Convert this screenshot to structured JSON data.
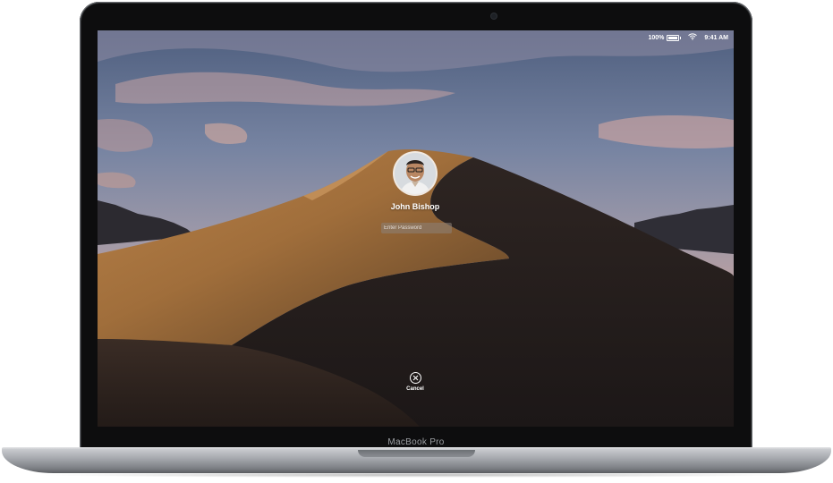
{
  "device": {
    "model_label": "MacBook Pro"
  },
  "status_bar": {
    "battery_percent": "100%",
    "time": "9:41 AM",
    "icons": [
      "battery-icon",
      "wifi-icon"
    ]
  },
  "login": {
    "user_name": "John Bishop",
    "password_placeholder": "Enter Password",
    "password_value": "",
    "cancel_label": "Cancel"
  },
  "colors": {
    "bezel": "#0d0d0e",
    "aluminum": "#a9acb1",
    "text_on_screen": "#ffffff"
  }
}
